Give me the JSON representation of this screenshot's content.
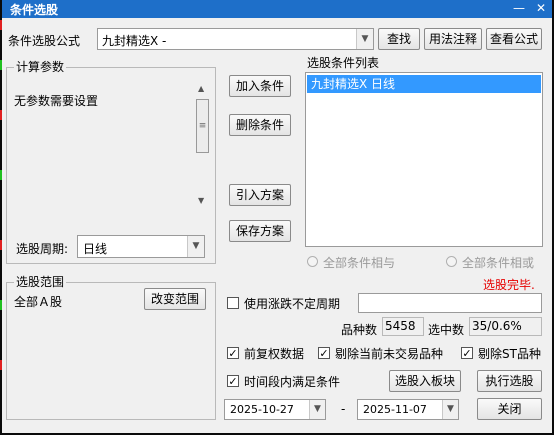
{
  "window": {
    "title": "条件选股",
    "minimize": "—",
    "close": "✕"
  },
  "formula": {
    "label": "条件选股公式",
    "value": "九封精选X  -",
    "find": "查找",
    "usage": "用法注释",
    "view": "查看公式"
  },
  "params": {
    "title": "计算参数",
    "text": "无参数需要设置",
    "period_label": "选股周期:",
    "period_value": "日线"
  },
  "actions": {
    "add": "加入条件",
    "delete": "删除条件",
    "import": "引入方案",
    "save": "保存方案"
  },
  "conditions": {
    "title": "选股条件列表",
    "items": [
      "九封精选X  日线"
    ]
  },
  "logic": {
    "and": "全部条件相与",
    "or": "全部条件相或"
  },
  "status": "选股完毕.",
  "scope": {
    "title": "选股范围",
    "value": "全部Ａ股",
    "change": "改变范围"
  },
  "uncertain": {
    "label": "使用涨跌不定周期"
  },
  "stats": {
    "count_label": "品种数",
    "count": "5458",
    "selected_label": "选中数",
    "selected": "35/0.6%"
  },
  "options": {
    "prior_adjust": "前复权数据",
    "exclude_untraded": "剔除当前未交易品种",
    "exclude_st": "剔除ST品种",
    "time_range": "时间段内满足条件"
  },
  "dates": {
    "start": "2025-10-27",
    "sep": "-",
    "end": "2025-11-07"
  },
  "buttons": {
    "to_block": "选股入板块",
    "execute": "执行选股",
    "close": "关闭"
  },
  "colors": {
    "title_bar": "#1e6fc9",
    "selection": "#3399ff",
    "status": "#e60000"
  }
}
